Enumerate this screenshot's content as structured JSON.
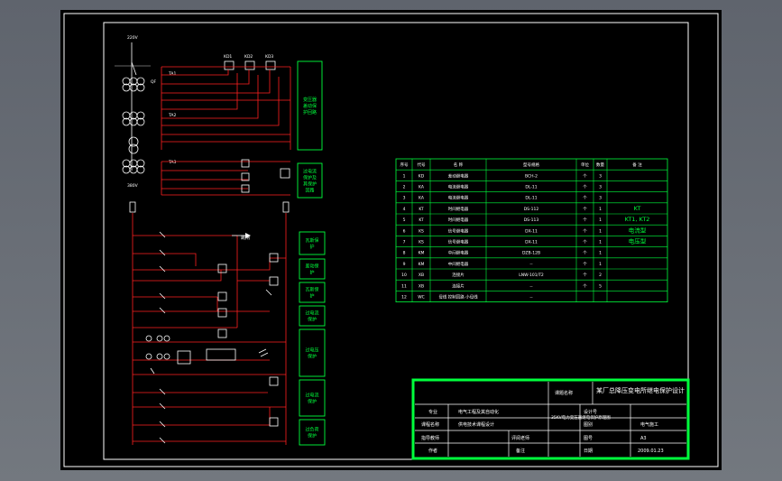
{
  "sheet": {
    "sources": [
      "220V",
      "380V"
    ],
    "top_labels": [
      "KD1",
      "KD2",
      "KD3"
    ],
    "relay_labels": [
      "TA1",
      "TA2",
      "TA3"
    ],
    "breaker_label": "QF",
    "section_boxes": [
      "变压器差动保护回路",
      "过电流保护及其保护回路",
      "瓦斯保护",
      "差动保护",
      "瓦斯保护",
      "过电流保护",
      "过电压保护",
      "过电流保护",
      "过负荷保护"
    ],
    "trip_label": "跳闸"
  },
  "table": {
    "headers": [
      "序号",
      "代号",
      "名 称",
      "型号规格",
      "单位",
      "数量",
      "备 注"
    ],
    "rows": [
      [
        "1",
        "KD",
        "差动继电器",
        "BCH-2",
        "个",
        "3",
        ""
      ],
      [
        "2",
        "KA",
        "电流继电器",
        "DL-11",
        "个",
        "3",
        ""
      ],
      [
        "3",
        "KA",
        "电流继电器",
        "DL-11",
        "个",
        "3",
        ""
      ],
      [
        "4",
        "KT",
        "时间继电器",
        "DS-112",
        "个",
        "1",
        "KT"
      ],
      [
        "5",
        "KT",
        "时间继电器",
        "DS-113",
        "个",
        "1",
        "KT1, KT2"
      ],
      [
        "6",
        "KS",
        "信号继电器",
        "DX-11",
        "个",
        "1",
        "电流型"
      ],
      [
        "7",
        "KS",
        "信号继电器",
        "DX-11",
        "个",
        "1",
        "电压型"
      ],
      [
        "8",
        "KM",
        "中间继电器",
        "DZB-12B",
        "个",
        "1",
        ""
      ],
      [
        "9",
        "KM",
        "中间继电器",
        "--",
        "个",
        "1",
        ""
      ],
      [
        "10",
        "XB",
        "连接片",
        "LNW-101/T2",
        "个",
        "2",
        ""
      ],
      [
        "11",
        "XB",
        "连接片",
        "--",
        "个",
        "5",
        ""
      ],
      [
        "12",
        "WC",
        "母线 控制回路 小母线",
        "--",
        "",
        "",
        ""
      ]
    ]
  },
  "title_block": {
    "project_name_label": "课题名称",
    "project_name": "某厂总降压变电所继电保护设计",
    "major_label": "专业",
    "major": "电气工程及其自动化",
    "course_label": "课程名称",
    "course": "供电技术课程设计",
    "drawing_name": "35KV电力变压器继电保护原理图",
    "design_no_label": "设计号",
    "drawing_type_label": "图别",
    "drawing_type": "电气施工",
    "instructor_label": "指导教师",
    "reviewer_label": "评阅老师",
    "sheet_label": "图号",
    "sheet_value": "A3",
    "author_label": "作者",
    "note_label": "备注",
    "date_label": "日期",
    "date": "2009.01.23"
  }
}
